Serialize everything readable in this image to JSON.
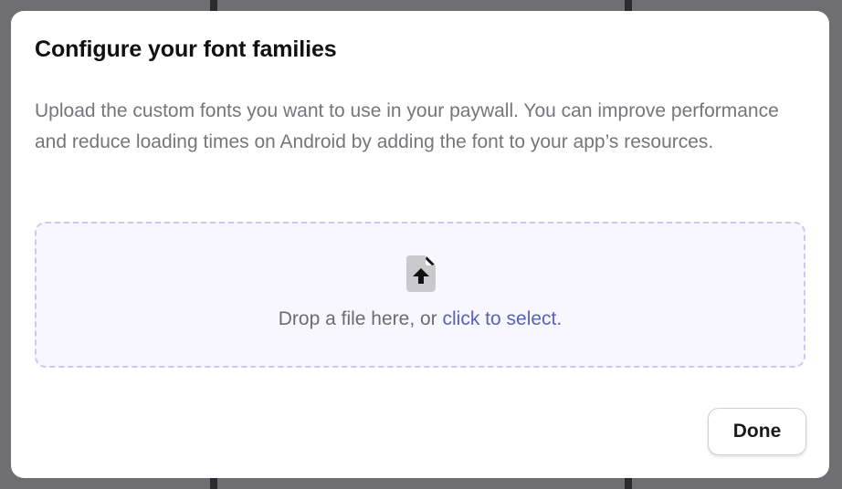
{
  "dialog": {
    "title": "Configure your font families",
    "description": "Upload the custom fonts you want to use in your paywall. You can improve performance and reduce loading times on Android by adding the font to your app’s resources."
  },
  "dropzone": {
    "icon": "file-upload-icon",
    "prompt": "Drop a file here, or ",
    "link_label": "click to select."
  },
  "actions": {
    "done_label": "Done"
  },
  "colors": {
    "link": "#5563b8",
    "dropzone_border": "#cfc6ef",
    "dropzone_background": "#f8f6ff",
    "overlay": "#6f6f72"
  }
}
